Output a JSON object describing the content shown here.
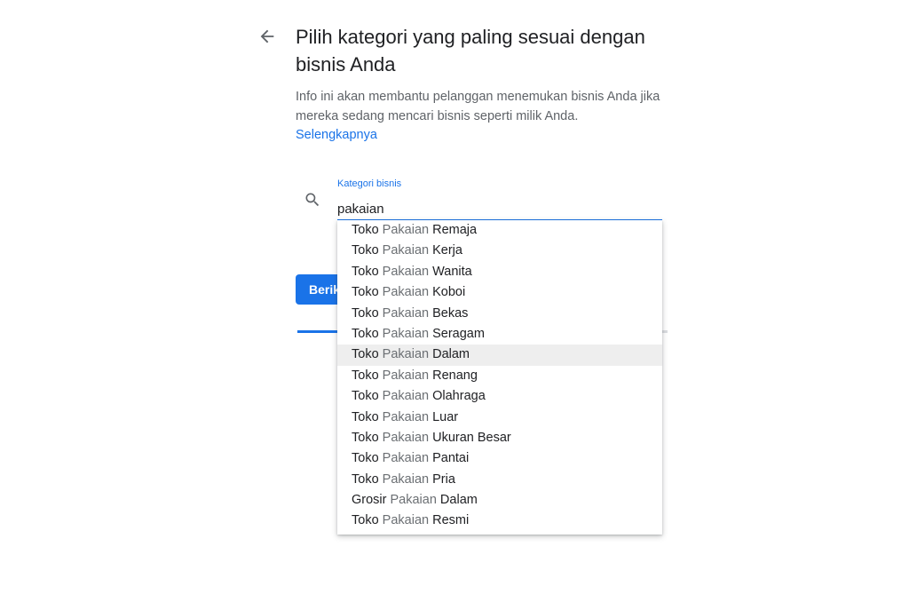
{
  "page": {
    "title": "Pilih kategori yang paling sesuai dengan bisnis Anda",
    "description": "Info ini akan membantu pelanggan menemukan bisnis Anda jika mereka sedang mencari bisnis seperti milik Anda.",
    "learn_more": "Selengkapnya"
  },
  "search": {
    "label": "Kategori bisnis",
    "value": "pakaian",
    "icon": "search-icon"
  },
  "next_button": {
    "label": "Berikutnya"
  },
  "progress": {
    "fraction": 0.11
  },
  "colors": {
    "accent": "#1a73e8",
    "highlight": "#eeeeee",
    "muted": "#6b6f73"
  },
  "suggestions": [
    {
      "prefix": "Toko ",
      "match": "Pakaian",
      "suffix": " Remaja"
    },
    {
      "prefix": "Toko ",
      "match": "Pakaian",
      "suffix": " Kerja"
    },
    {
      "prefix": "Toko ",
      "match": "Pakaian",
      "suffix": " Wanita"
    },
    {
      "prefix": "Toko ",
      "match": "Pakaian",
      "suffix": " Koboi"
    },
    {
      "prefix": "Toko ",
      "match": "Pakaian",
      "suffix": " Bekas"
    },
    {
      "prefix": "Toko ",
      "match": "Pakaian",
      "suffix": " Seragam"
    },
    {
      "prefix": "Toko ",
      "match": "Pakaian",
      "suffix": " Dalam",
      "highlighted": true
    },
    {
      "prefix": "Toko ",
      "match": "Pakaian",
      "suffix": " Renang"
    },
    {
      "prefix": "Toko ",
      "match": "Pakaian",
      "suffix": " Olahraga"
    },
    {
      "prefix": "Toko ",
      "match": "Pakaian",
      "suffix": " Luar"
    },
    {
      "prefix": "Toko ",
      "match": "Pakaian",
      "suffix": " Ukuran Besar"
    },
    {
      "prefix": "Toko ",
      "match": "Pakaian",
      "suffix": " Pantai"
    },
    {
      "prefix": "Toko ",
      "match": "Pakaian",
      "suffix": " Pria"
    },
    {
      "prefix": "Grosir ",
      "match": "Pakaian",
      "suffix": " Dalam"
    },
    {
      "prefix": "Toko ",
      "match": "Pakaian",
      "suffix": " Resmi"
    }
  ]
}
